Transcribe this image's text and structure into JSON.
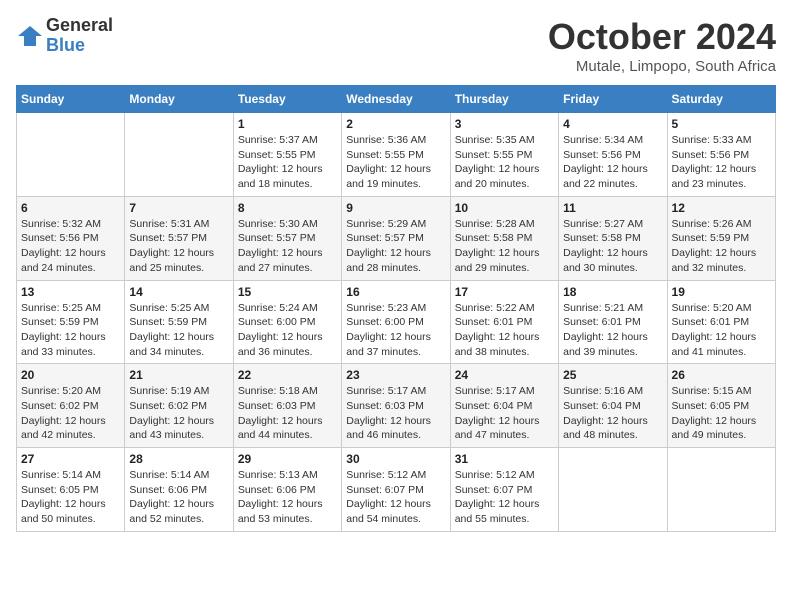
{
  "logo": {
    "general": "General",
    "blue": "Blue"
  },
  "title": "October 2024",
  "location": "Mutale, Limpopo, South Africa",
  "days_of_week": [
    "Sunday",
    "Monday",
    "Tuesday",
    "Wednesday",
    "Thursday",
    "Friday",
    "Saturday"
  ],
  "weeks": [
    [
      {
        "day": null,
        "info": null
      },
      {
        "day": null,
        "info": null
      },
      {
        "day": "1",
        "info": "Sunrise: 5:37 AM\nSunset: 5:55 PM\nDaylight: 12 hours and 18 minutes."
      },
      {
        "day": "2",
        "info": "Sunrise: 5:36 AM\nSunset: 5:55 PM\nDaylight: 12 hours and 19 minutes."
      },
      {
        "day": "3",
        "info": "Sunrise: 5:35 AM\nSunset: 5:55 PM\nDaylight: 12 hours and 20 minutes."
      },
      {
        "day": "4",
        "info": "Sunrise: 5:34 AM\nSunset: 5:56 PM\nDaylight: 12 hours and 22 minutes."
      },
      {
        "day": "5",
        "info": "Sunrise: 5:33 AM\nSunset: 5:56 PM\nDaylight: 12 hours and 23 minutes."
      }
    ],
    [
      {
        "day": "6",
        "info": "Sunrise: 5:32 AM\nSunset: 5:56 PM\nDaylight: 12 hours and 24 minutes."
      },
      {
        "day": "7",
        "info": "Sunrise: 5:31 AM\nSunset: 5:57 PM\nDaylight: 12 hours and 25 minutes."
      },
      {
        "day": "8",
        "info": "Sunrise: 5:30 AM\nSunset: 5:57 PM\nDaylight: 12 hours and 27 minutes."
      },
      {
        "day": "9",
        "info": "Sunrise: 5:29 AM\nSunset: 5:57 PM\nDaylight: 12 hours and 28 minutes."
      },
      {
        "day": "10",
        "info": "Sunrise: 5:28 AM\nSunset: 5:58 PM\nDaylight: 12 hours and 29 minutes."
      },
      {
        "day": "11",
        "info": "Sunrise: 5:27 AM\nSunset: 5:58 PM\nDaylight: 12 hours and 30 minutes."
      },
      {
        "day": "12",
        "info": "Sunrise: 5:26 AM\nSunset: 5:59 PM\nDaylight: 12 hours and 32 minutes."
      }
    ],
    [
      {
        "day": "13",
        "info": "Sunrise: 5:25 AM\nSunset: 5:59 PM\nDaylight: 12 hours and 33 minutes."
      },
      {
        "day": "14",
        "info": "Sunrise: 5:25 AM\nSunset: 5:59 PM\nDaylight: 12 hours and 34 minutes."
      },
      {
        "day": "15",
        "info": "Sunrise: 5:24 AM\nSunset: 6:00 PM\nDaylight: 12 hours and 36 minutes."
      },
      {
        "day": "16",
        "info": "Sunrise: 5:23 AM\nSunset: 6:00 PM\nDaylight: 12 hours and 37 minutes."
      },
      {
        "day": "17",
        "info": "Sunrise: 5:22 AM\nSunset: 6:01 PM\nDaylight: 12 hours and 38 minutes."
      },
      {
        "day": "18",
        "info": "Sunrise: 5:21 AM\nSunset: 6:01 PM\nDaylight: 12 hours and 39 minutes."
      },
      {
        "day": "19",
        "info": "Sunrise: 5:20 AM\nSunset: 6:01 PM\nDaylight: 12 hours and 41 minutes."
      }
    ],
    [
      {
        "day": "20",
        "info": "Sunrise: 5:20 AM\nSunset: 6:02 PM\nDaylight: 12 hours and 42 minutes."
      },
      {
        "day": "21",
        "info": "Sunrise: 5:19 AM\nSunset: 6:02 PM\nDaylight: 12 hours and 43 minutes."
      },
      {
        "day": "22",
        "info": "Sunrise: 5:18 AM\nSunset: 6:03 PM\nDaylight: 12 hours and 44 minutes."
      },
      {
        "day": "23",
        "info": "Sunrise: 5:17 AM\nSunset: 6:03 PM\nDaylight: 12 hours and 46 minutes."
      },
      {
        "day": "24",
        "info": "Sunrise: 5:17 AM\nSunset: 6:04 PM\nDaylight: 12 hours and 47 minutes."
      },
      {
        "day": "25",
        "info": "Sunrise: 5:16 AM\nSunset: 6:04 PM\nDaylight: 12 hours and 48 minutes."
      },
      {
        "day": "26",
        "info": "Sunrise: 5:15 AM\nSunset: 6:05 PM\nDaylight: 12 hours and 49 minutes."
      }
    ],
    [
      {
        "day": "27",
        "info": "Sunrise: 5:14 AM\nSunset: 6:05 PM\nDaylight: 12 hours and 50 minutes."
      },
      {
        "day": "28",
        "info": "Sunrise: 5:14 AM\nSunset: 6:06 PM\nDaylight: 12 hours and 52 minutes."
      },
      {
        "day": "29",
        "info": "Sunrise: 5:13 AM\nSunset: 6:06 PM\nDaylight: 12 hours and 53 minutes."
      },
      {
        "day": "30",
        "info": "Sunrise: 5:12 AM\nSunset: 6:07 PM\nDaylight: 12 hours and 54 minutes."
      },
      {
        "day": "31",
        "info": "Sunrise: 5:12 AM\nSunset: 6:07 PM\nDaylight: 12 hours and 55 minutes."
      },
      {
        "day": null,
        "info": null
      },
      {
        "day": null,
        "info": null
      }
    ]
  ]
}
